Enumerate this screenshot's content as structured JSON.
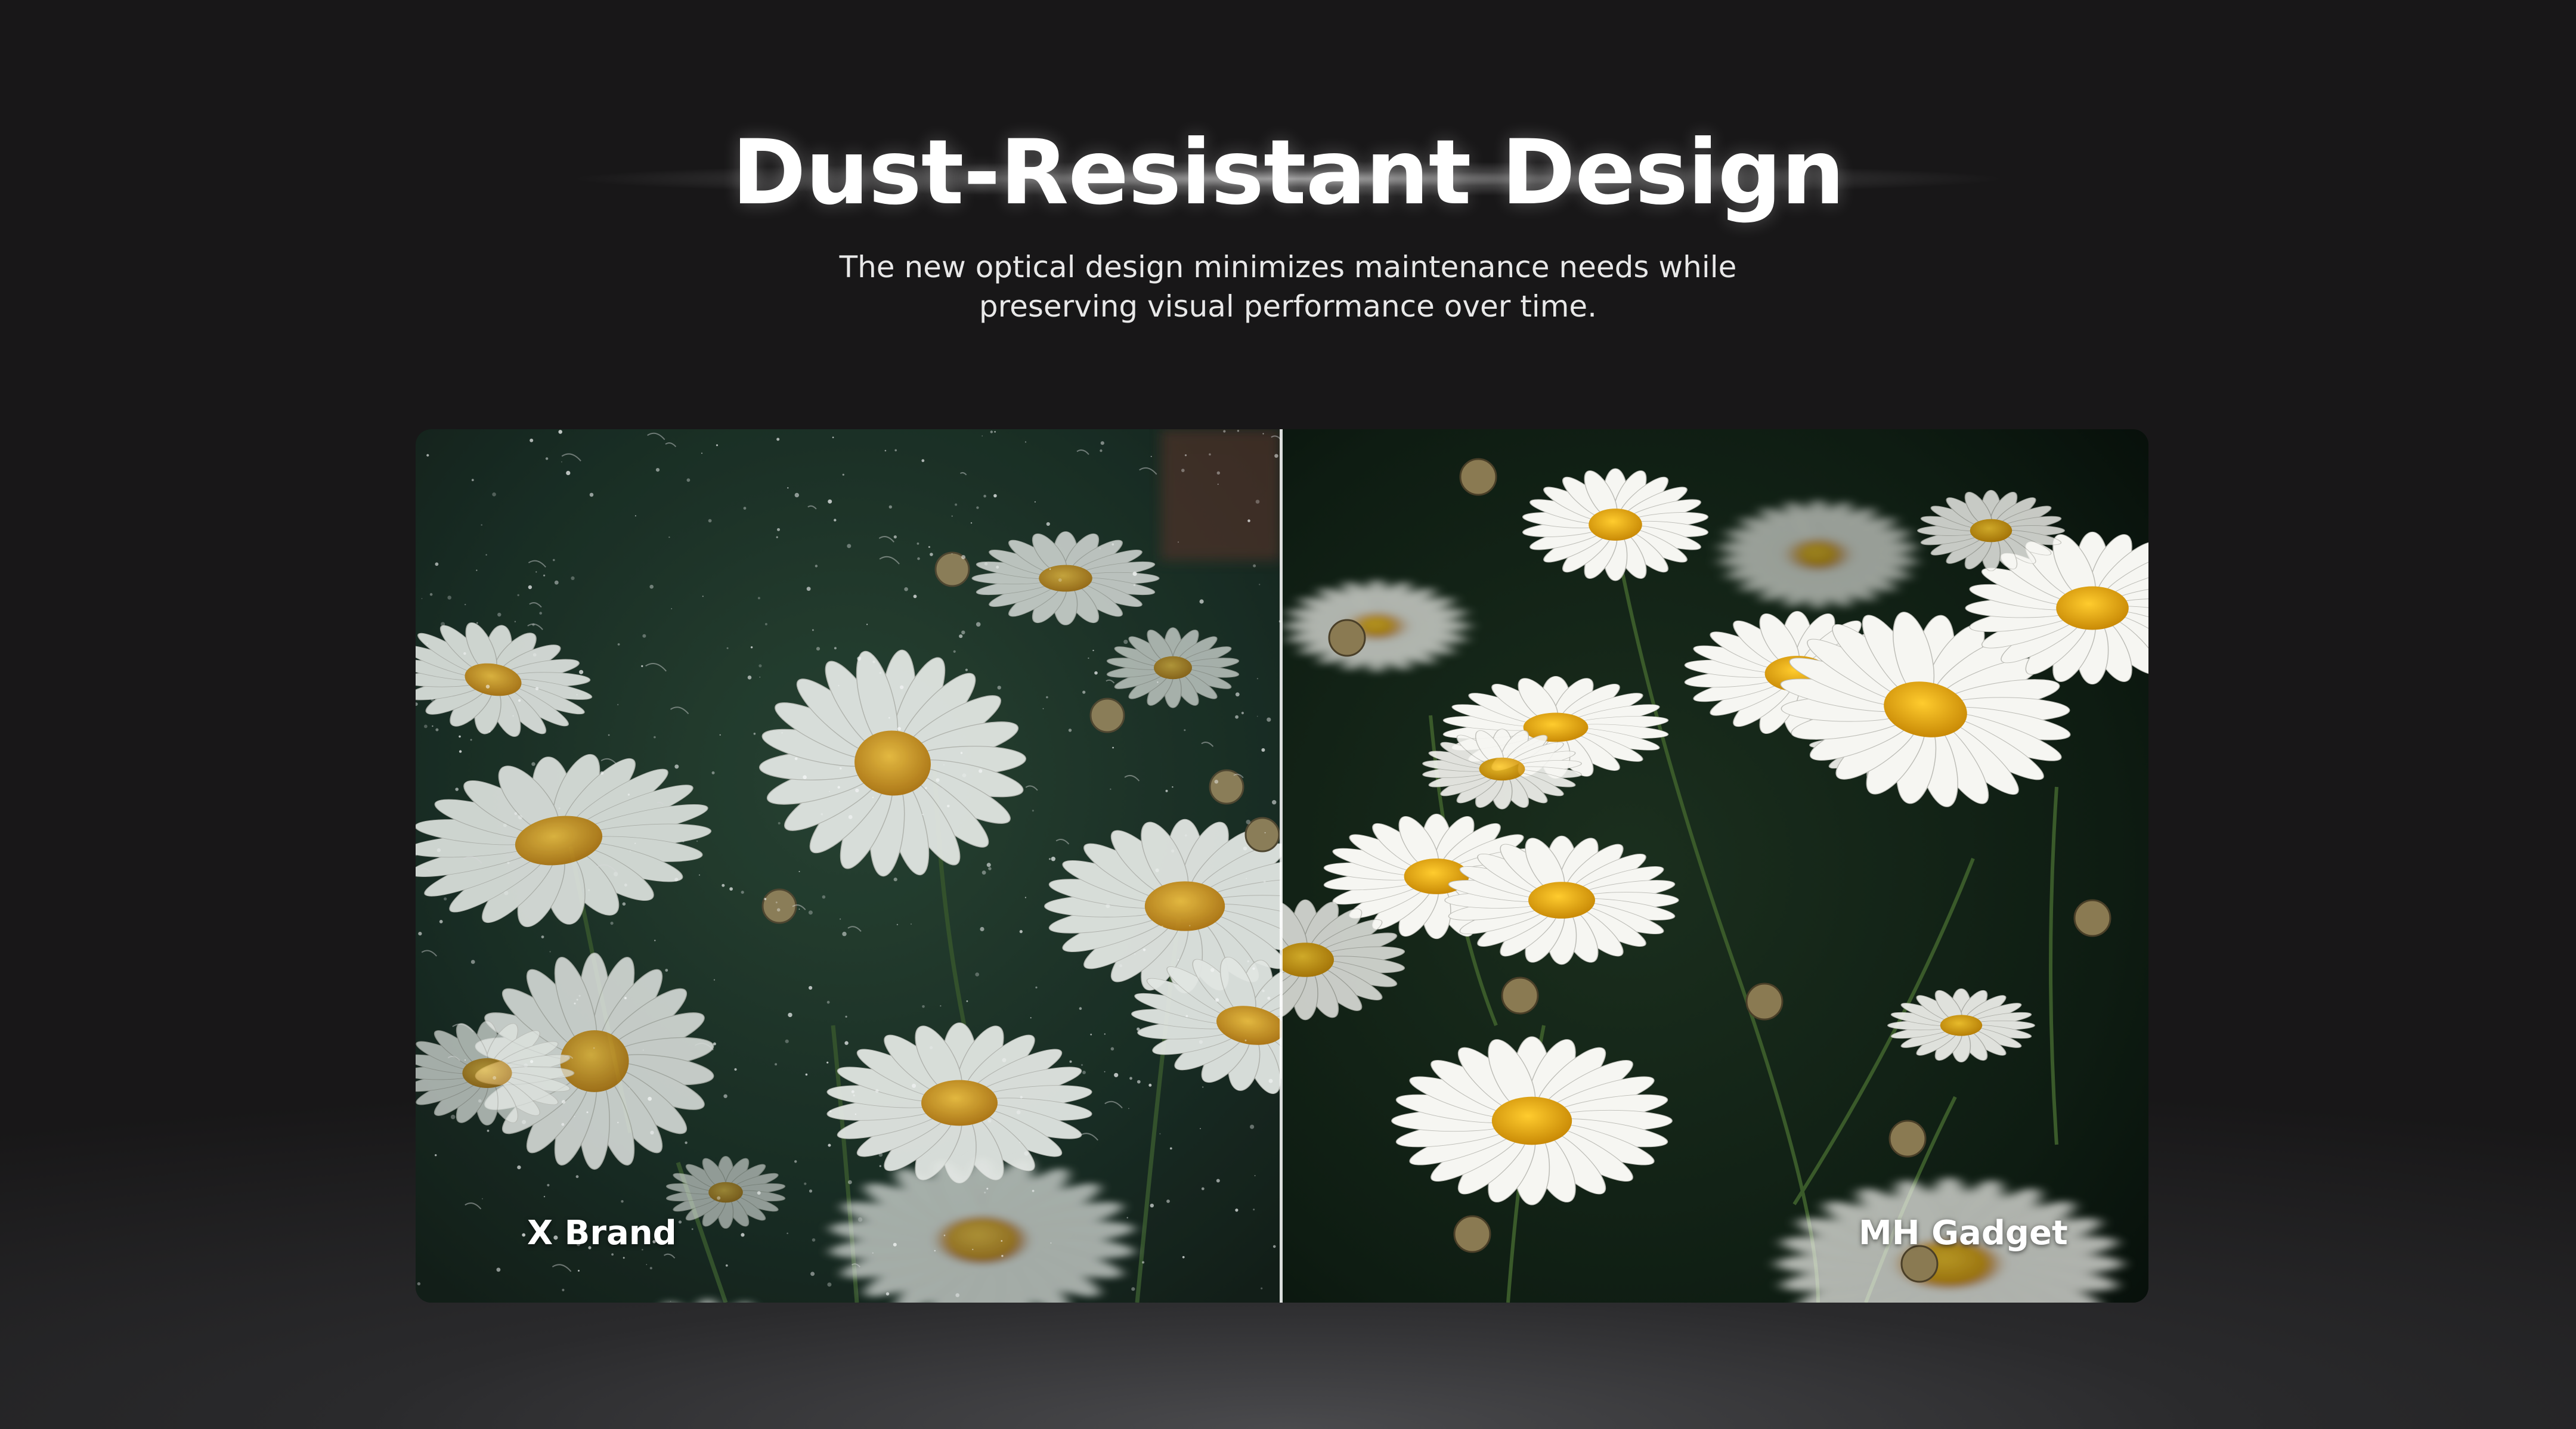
{
  "header": {
    "title": "Dust-Resistant Design",
    "subtitle": "The new optical design minimizes maintenance needs while preserving visual performance over time."
  },
  "comparison": {
    "left_label": "X Brand",
    "right_label": "MH Gadget",
    "image_subject": "daisy-field-photo",
    "left_state": "dusty",
    "right_state": "clean",
    "divider_position": 0.5
  },
  "colors": {
    "background": "#181718",
    "text": "#ffffff",
    "petal": "#f2f2ee",
    "flower_center": "#e0a014",
    "foliage": "#12261a"
  }
}
